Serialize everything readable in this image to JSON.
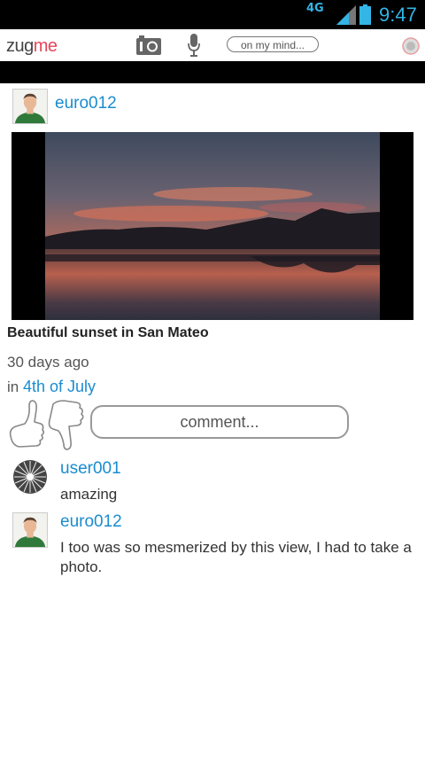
{
  "status_bar": {
    "network": "4G",
    "time": "9:47"
  },
  "app_bar": {
    "logo_part1": "zug",
    "logo_part2": "me",
    "status_prompt": "on my mind..."
  },
  "post": {
    "author": "euro012",
    "caption": "Beautiful sunset in San Mateo",
    "age": "30 days ago",
    "in_prefix": "in",
    "event": "4th of July"
  },
  "comment_placeholder": "comment...",
  "comments": [
    {
      "user": "user001",
      "text": "amazing"
    },
    {
      "user": "euro012",
      "text": "I too was so mesmerized by this view, I had to take a photo."
    }
  ]
}
